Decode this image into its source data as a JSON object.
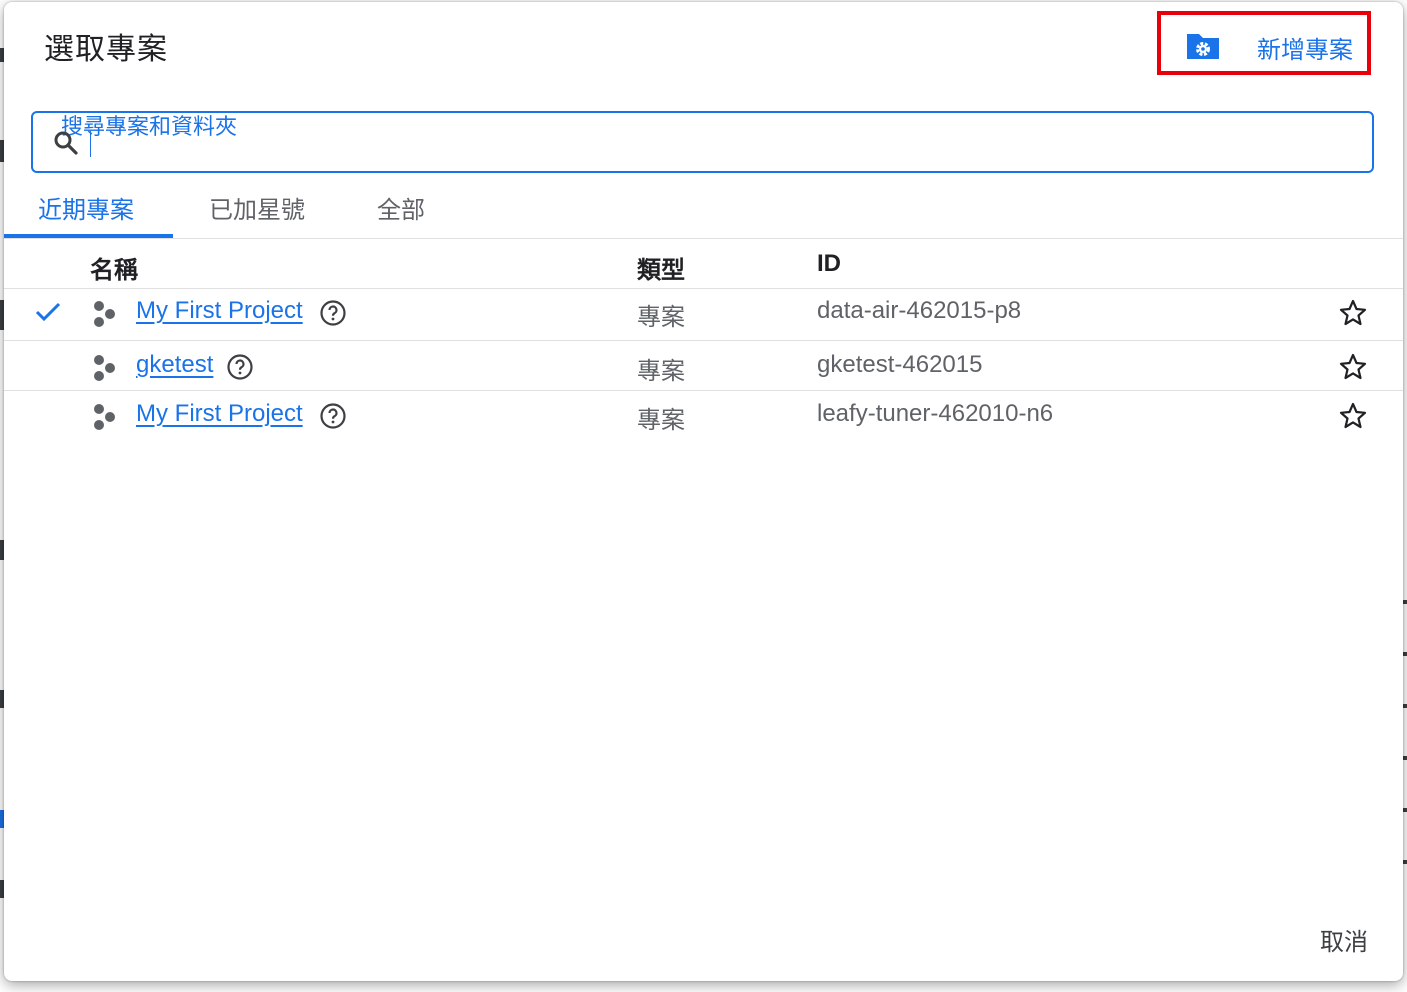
{
  "dialog": {
    "title": "選取專案",
    "new_project_label": "新增專案",
    "search": {
      "floating_label": "搜尋專案和資料夾",
      "value": ""
    },
    "tabs": [
      {
        "label": "近期專案",
        "active": true
      },
      {
        "label": "已加星號",
        "active": false
      },
      {
        "label": "全部",
        "active": false
      }
    ],
    "table": {
      "headers": {
        "name": "名稱",
        "type": "類型",
        "id": "ID"
      },
      "rows": [
        {
          "selected": true,
          "name": "My First Project",
          "type": "專案",
          "id": "data-air-462015-p8",
          "starred": false
        },
        {
          "selected": false,
          "name": "gketest",
          "type": "專案",
          "id": "gketest-462015",
          "starred": false
        },
        {
          "selected": false,
          "name": "My First Project",
          "type": "專案",
          "id": "leafy-tuner-462010-n6",
          "starred": false
        }
      ]
    },
    "cancel_label": "取消"
  },
  "icons": {
    "new_project": "folder-gear-icon",
    "search": "search-icon",
    "selected": "check-icon",
    "project": "project-hexagons-icon",
    "help": "help-circle-icon",
    "star": "star-outline-icon"
  },
  "colors": {
    "accent": "#1a73e8",
    "highlight_box": "#e8000b",
    "text_secondary": "#5f6368"
  }
}
